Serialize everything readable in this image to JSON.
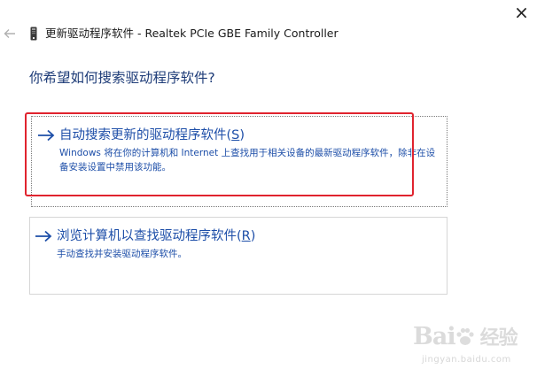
{
  "window": {
    "title": "更新驱动程序软件 - Realtek PCIe GBE Family Controller",
    "close_label": "×"
  },
  "page": {
    "question": "你希望如何搜索驱动程序软件?"
  },
  "options": [
    {
      "title": "自动搜索更新的驱动程序软件(",
      "accel": "S",
      "title_end": ")",
      "description": "Windows 将在你的计算机和 Internet 上查找用于相关设备的最新驱动程序软件，除非在设备安装设置中禁用该功能。"
    },
    {
      "title": "浏览计算机以查找驱动程序软件(",
      "accel": "R",
      "title_end": ")",
      "description": "手动查找并安装驱动程序软件。"
    }
  ],
  "watermark": {
    "brand_left": "Bai",
    "brand_right": "经验",
    "site": "jingyan.baidu.com"
  },
  "colors": {
    "link_blue": "#1d4ea8",
    "heading_blue": "#1e3c78",
    "highlight_red": "#e0232e"
  },
  "icons": {
    "back": "back-arrow-icon",
    "device": "network-adapter-icon",
    "option_arrow": "right-arrow-icon",
    "close": "close-icon"
  }
}
